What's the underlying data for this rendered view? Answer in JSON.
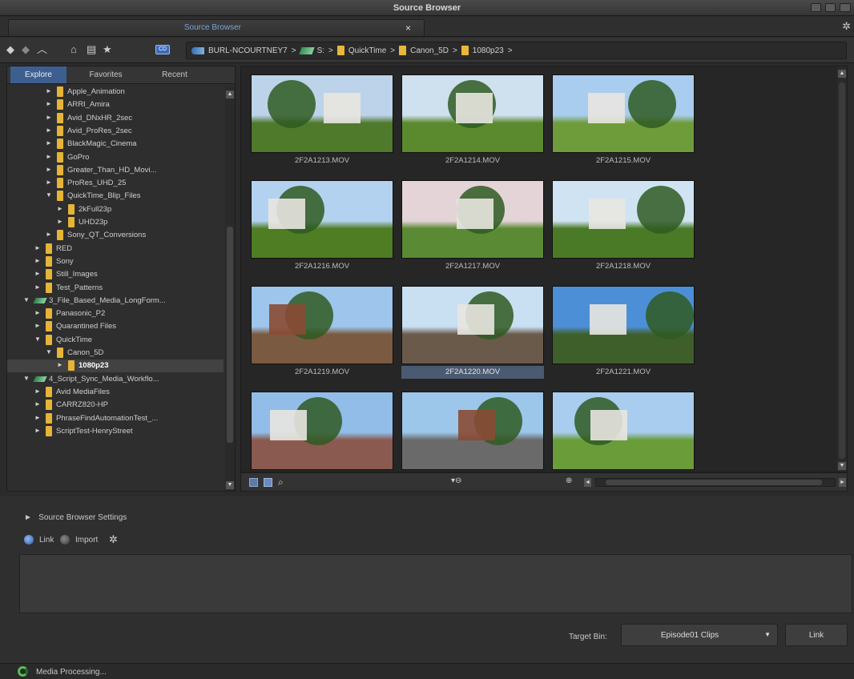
{
  "window": {
    "title": "Source Browser"
  },
  "tab": {
    "label": "Source Browser",
    "close": "×"
  },
  "toolbar": {
    "icons": [
      "back-icon",
      "forward-icon",
      "up-icon",
      "home-icon",
      "bookmarks-icon",
      "favorite-star-icon",
      "cd-icon"
    ],
    "breadcrumb": [
      {
        "label": "BURL-NCOURTNEY7",
        "icon": "computer"
      },
      {
        "label": "S:",
        "icon": "drive"
      },
      {
        "label": "QuickTime",
        "icon": "folder"
      },
      {
        "label": "Canon_5D",
        "icon": "folder"
      },
      {
        "label": "1080p23",
        "icon": "folder"
      }
    ],
    "separator": ">"
  },
  "left_tabs": [
    "Explore",
    "Favorites",
    "Recent"
  ],
  "tree": [
    {
      "label": "Apple_Animation",
      "depth": 3,
      "type": "folder",
      "arrow": "►"
    },
    {
      "label": "ARRI_Amira",
      "depth": 3,
      "type": "folder",
      "arrow": "►"
    },
    {
      "label": "Avid_DNxHR_2sec",
      "depth": 3,
      "type": "folder",
      "arrow": "►"
    },
    {
      "label": "Avid_ProRes_2sec",
      "depth": 3,
      "type": "folder",
      "arrow": "►"
    },
    {
      "label": "BlackMagic_Cinema",
      "depth": 3,
      "type": "folder",
      "arrow": "►"
    },
    {
      "label": "GoPro",
      "depth": 3,
      "type": "folder",
      "arrow": "►"
    },
    {
      "label": "Greater_Than_HD_Movi...",
      "depth": 3,
      "type": "folder",
      "arrow": "►"
    },
    {
      "label": "ProRes_UHD_25",
      "depth": 3,
      "type": "folder",
      "arrow": "►"
    },
    {
      "label": "QuickTime_Blip_Files",
      "depth": 3,
      "type": "folder",
      "arrow": "▼"
    },
    {
      "label": "2kFull23p",
      "depth": 4,
      "type": "folder",
      "arrow": "►"
    },
    {
      "label": "UHD23p",
      "depth": 4,
      "type": "folder",
      "arrow": "►"
    },
    {
      "label": "Sony_QT_Conversions",
      "depth": 3,
      "type": "folder",
      "arrow": "►"
    },
    {
      "label": "RED",
      "depth": 2,
      "type": "folder",
      "arrow": "►"
    },
    {
      "label": "Sony",
      "depth": 2,
      "type": "folder",
      "arrow": "►"
    },
    {
      "label": "Still_Images",
      "depth": 2,
      "type": "folder",
      "arrow": "►"
    },
    {
      "label": "Test_Patterns",
      "depth": 2,
      "type": "folder",
      "arrow": "►"
    },
    {
      "label": "3_File_Based_Media_LongForm...",
      "depth": 1,
      "type": "drive",
      "arrow": "▼"
    },
    {
      "label": "Panasonic_P2",
      "depth": 2,
      "type": "folder",
      "arrow": "►"
    },
    {
      "label": "Quarantined Files",
      "depth": 2,
      "type": "folder",
      "arrow": "►"
    },
    {
      "label": "QuickTime",
      "depth": 2,
      "type": "folder",
      "arrow": "▼"
    },
    {
      "label": "Canon_5D",
      "depth": 3,
      "type": "folder",
      "arrow": "▼"
    },
    {
      "label": "1080p23",
      "depth": 4,
      "type": "folder",
      "arrow": "►",
      "selected": true
    },
    {
      "label": "4_Script_Sync_Media_Workflo...",
      "depth": 1,
      "type": "drive",
      "arrow": "▼"
    },
    {
      "label": "Avid MediaFiles",
      "depth": 2,
      "type": "folder",
      "arrow": "►"
    },
    {
      "label": "CARRZ820-HP",
      "depth": 2,
      "type": "folder",
      "arrow": "►"
    },
    {
      "label": "PhraseFindAutomationTest_...",
      "depth": 2,
      "type": "folder",
      "arrow": "►"
    },
    {
      "label": "ScriptTest-HenryStreet",
      "depth": 2,
      "type": "folder",
      "arrow": "►"
    }
  ],
  "thumbnails": [
    {
      "name": "2F2A1213.MOV",
      "scene": "house-path",
      "sky": "#bcd3ea",
      "ground": "#4f7a2c"
    },
    {
      "name": "2F2A1214.MOV",
      "scene": "tree-lawn",
      "sky": "#cfe0ef",
      "ground": "#5b8a2e"
    },
    {
      "name": "2F2A1215.MOV",
      "scene": "trees-sky",
      "sky": "#a9cdee",
      "ground": "#6f9c3a"
    },
    {
      "name": "2F2A1216.MOV",
      "scene": "building-sign",
      "sky": "#b3d2ef",
      "ground": "#4e7d24"
    },
    {
      "name": "2F2A1217.MOV",
      "scene": "house-flare",
      "sky": "#e4d4d8",
      "ground": "#5a8a33"
    },
    {
      "name": "2F2A1218.MOV",
      "scene": "mural",
      "sky": "#cfe3f3",
      "ground": "#4b7a26"
    },
    {
      "name": "2F2A1219.MOV",
      "scene": "steeple-scaffold",
      "sky": "#9ec5ec",
      "ground": "#7a5a40"
    },
    {
      "name": "2F2A1220.MOV",
      "scene": "scaffold-tree",
      "sky": "#c9dff2",
      "ground": "#6a5a4a",
      "selected": true
    },
    {
      "name": "2F2A1221.MOV",
      "scene": "church",
      "sky": "#4d8fd6",
      "ground": "#3f5f2a"
    },
    {
      "name": "",
      "scene": "street-lamp",
      "sky": "#92bde8",
      "ground": "#8a5a50"
    },
    {
      "name": "",
      "scene": "brick-building",
      "sky": "#9cc6ea",
      "ground": "#6a6a6a"
    },
    {
      "name": "",
      "scene": "park-trees",
      "sky": "#a8cdee",
      "ground": "#6a9c3a"
    }
  ],
  "settings": {
    "toggle": "Source Browser Settings",
    "link_label": "Link",
    "import_label": "Import",
    "target_bin_label": "Target Bin:",
    "target_bin_value": "Episode01 Clips",
    "link_button": "Link"
  },
  "status": {
    "text": "Media Processing..."
  },
  "colors": {
    "accent": "#3d5f8f",
    "folder": "#e6b437",
    "tab_text": "#7da2d8"
  }
}
